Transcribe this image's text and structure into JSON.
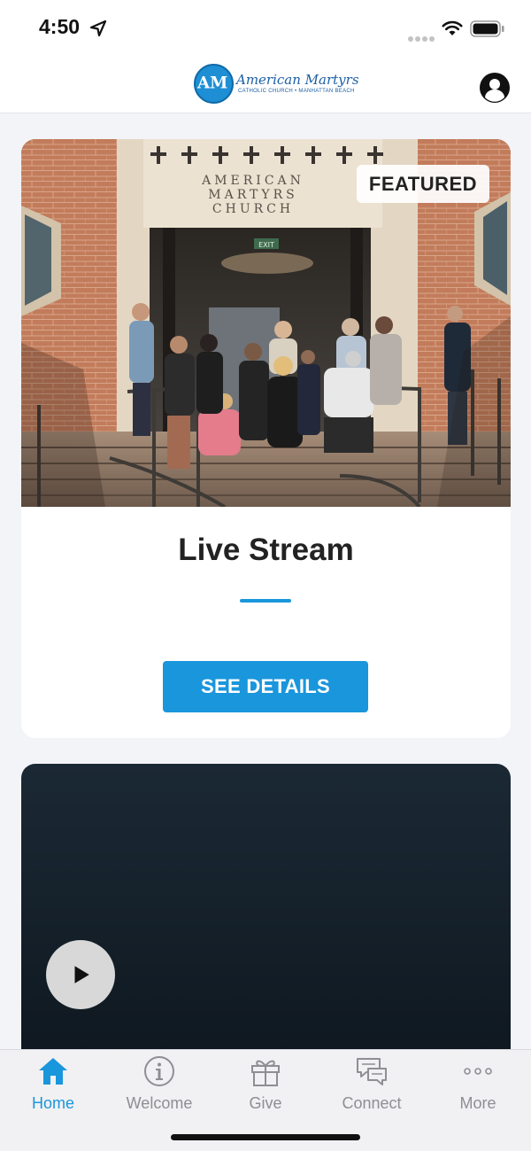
{
  "status_bar": {
    "time": "4:50",
    "icons": [
      "location-arrow-icon",
      "signal-dots-icon",
      "wifi-icon",
      "battery-icon"
    ]
  },
  "header": {
    "logo_text": "American Martyrs",
    "logo_subtext": "CATHOLIC CHURCH • MANHATTAN BEACH",
    "profile_icon": "person-circle-icon"
  },
  "featured_card": {
    "badge": "FEATURED",
    "title": "Live Stream",
    "button_label": "SEE DETAILS",
    "image_sign_text": [
      "AMERICAN",
      "MARTYRS",
      "CHURCH"
    ],
    "image_exit_sign": "EXIT"
  },
  "video_card": {
    "play_icon": "play-icon"
  },
  "tab_bar": {
    "tabs": [
      {
        "label": "Home",
        "icon": "home-icon",
        "active": true
      },
      {
        "label": "Welcome",
        "icon": "info-icon",
        "active": false
      },
      {
        "label": "Give",
        "icon": "gift-icon",
        "active": false
      },
      {
        "label": "Connect",
        "icon": "chat-bubbles-icon",
        "active": false
      },
      {
        "label": "More",
        "icon": "more-dots-icon",
        "active": false
      }
    ]
  },
  "colors": {
    "accent": "#1a96dc",
    "background": "#f3f4f8",
    "tab_inactive": "#8e8e93",
    "video_bg": "#1b2935"
  }
}
